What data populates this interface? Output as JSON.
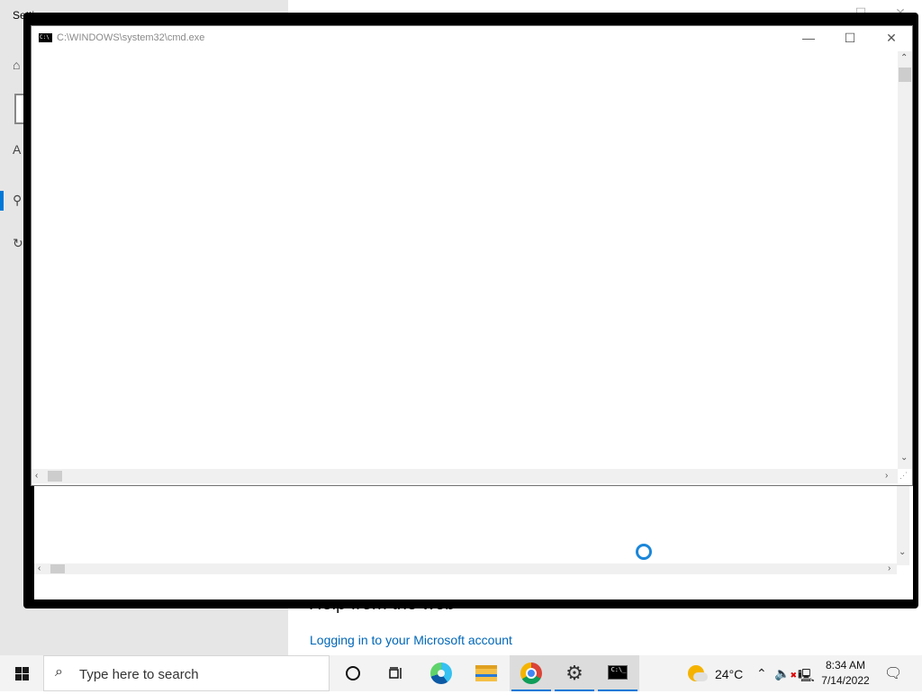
{
  "settings_window": {
    "title": "Settings",
    "nav_letter": "A",
    "help_heading": "Help from the web",
    "help_link": "Logging in to your Microsoft account"
  },
  "cmd_window": {
    "title": "C:\\WINDOWS\\system32\\cmd.exe",
    "minimize_glyph": "—",
    "maximize_glyph": "☐",
    "close_glyph": "✕"
  },
  "taskbar": {
    "search_placeholder": "Type here to search",
    "items": [
      {
        "name": "cortana",
        "icon": "cortana-icon"
      },
      {
        "name": "task-view",
        "icon": "task-view-icon"
      },
      {
        "name": "edge",
        "icon": "edge-icon"
      },
      {
        "name": "file-explorer",
        "icon": "folder-icon"
      },
      {
        "name": "chrome",
        "icon": "chrome-icon"
      },
      {
        "name": "settings",
        "icon": "gear-icon"
      },
      {
        "name": "command-prompt",
        "icon": "cmd-icon"
      }
    ],
    "weather_temp": "24°C",
    "time": "8:34 AM",
    "date": "7/14/2022"
  },
  "colors": {
    "accent": "#0078d7",
    "link": "#0067b8",
    "taskbar_bg": "#f3f3f3"
  }
}
